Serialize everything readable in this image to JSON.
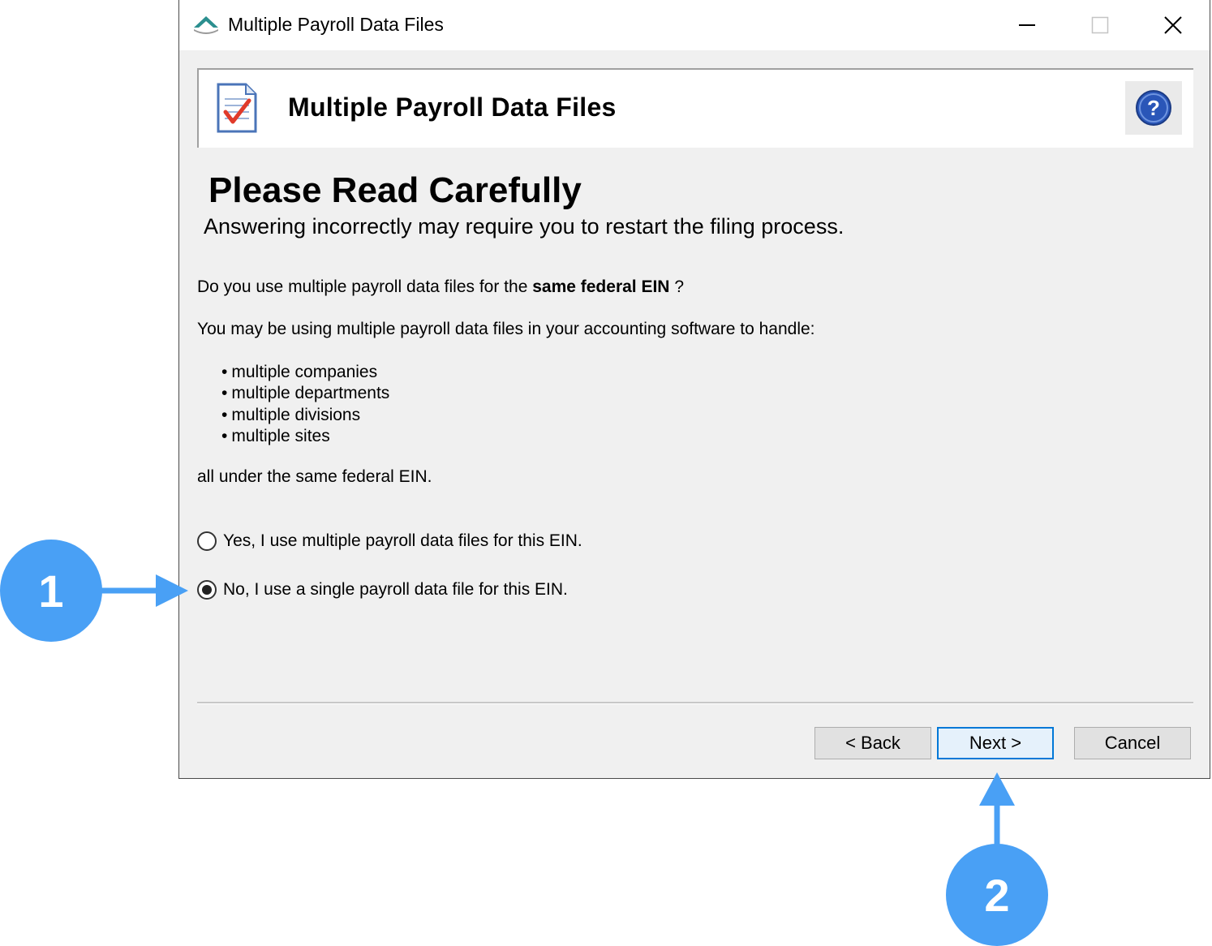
{
  "window": {
    "title": "Multiple Payroll Data Files",
    "controls": {
      "minimize": "minimize-icon",
      "maximize": "maximize-icon",
      "close": "close-icon"
    }
  },
  "banner": {
    "title": "Multiple Payroll Data Files",
    "help_icon": "question-mark-icon"
  },
  "content": {
    "heading": "Please Read Carefully",
    "subheading": "Answering incorrectly may require you to restart the filing process.",
    "question_prefix": "Do you use multiple payroll data files for the ",
    "question_bold": "same federal EIN",
    "question_suffix": " ?",
    "explanation": "You may be using multiple payroll data files in your accounting software to handle:",
    "bullets": [
      "multiple companies",
      "multiple departments",
      "multiple divisions",
      "multiple sites"
    ],
    "footer_note": "all under the same federal EIN."
  },
  "options": [
    {
      "label": "Yes, I use multiple payroll data files for this EIN.",
      "checked": false
    },
    {
      "label": "No, I use a single payroll data file for this EIN.",
      "checked": true
    }
  ],
  "buttons": {
    "back": "< Back",
    "next": "Next >",
    "cancel": "Cancel"
  },
  "callouts": [
    "1",
    "2"
  ],
  "colors": {
    "callout": "#49a0f5",
    "accent_border": "#0078d7",
    "window_bg": "#f0f0f0"
  }
}
